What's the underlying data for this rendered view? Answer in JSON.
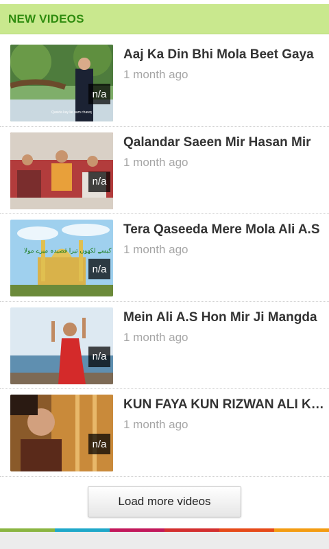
{
  "section": {
    "title": "NEW VIDEOS"
  },
  "videos": [
    {
      "title": "Aaj Ka Din Bhi Mola Beet Gaya",
      "time": "1 month ago",
      "badge": "n/a",
      "thumb_caption": "Qasida kay ke nam chawq"
    },
    {
      "title": "Qalandar Saeen Mir Hasan Mir",
      "time": "1 month ago",
      "badge": "n/a"
    },
    {
      "title": "Tera Qaseeda Mere Mola Ali A.S",
      "time": "1 month ago",
      "badge": "n/a",
      "thumb_caption": "میں کیسے لکھوں تیرا قصیدہ میرے مولا"
    },
    {
      "title": "Mein Ali A.S Hon Mir Ji Mangda",
      "time": "1 month ago",
      "badge": "n/a"
    },
    {
      "title": "KUN FAYA KUN RIZWAN ALI KHAN",
      "time": "1 month ago",
      "badge": "n/a"
    }
  ],
  "load_more": {
    "label": "Load more videos"
  },
  "colors": {
    "header_bg": "#c9e88e",
    "header_text": "#2e8b0e",
    "strip": [
      "#8ab541",
      "#1fa8c9",
      "#c2185b",
      "#d32f2f",
      "#e64a19",
      "#f39c12"
    ]
  }
}
